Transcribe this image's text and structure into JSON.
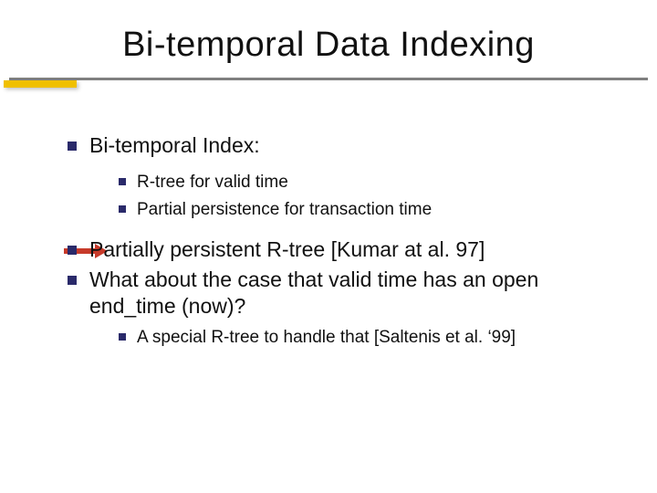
{
  "title": "Bi-temporal Data Indexing",
  "section": {
    "heading": "Bi-temporal Index:",
    "items": [
      "R-tree for valid time",
      "Partial persistence for transaction time"
    ]
  },
  "points": [
    "Partially persistent R-tree [Kumar at al. 97]",
    "What about the case that valid time has an open end_time (now)?"
  ],
  "sub2": "A special R-tree to handle that [Saltenis et al. ‘99]",
  "colors": {
    "bullet": "#2a2a6a",
    "accent": "#f0c000",
    "arrow": "#c73a2a"
  }
}
